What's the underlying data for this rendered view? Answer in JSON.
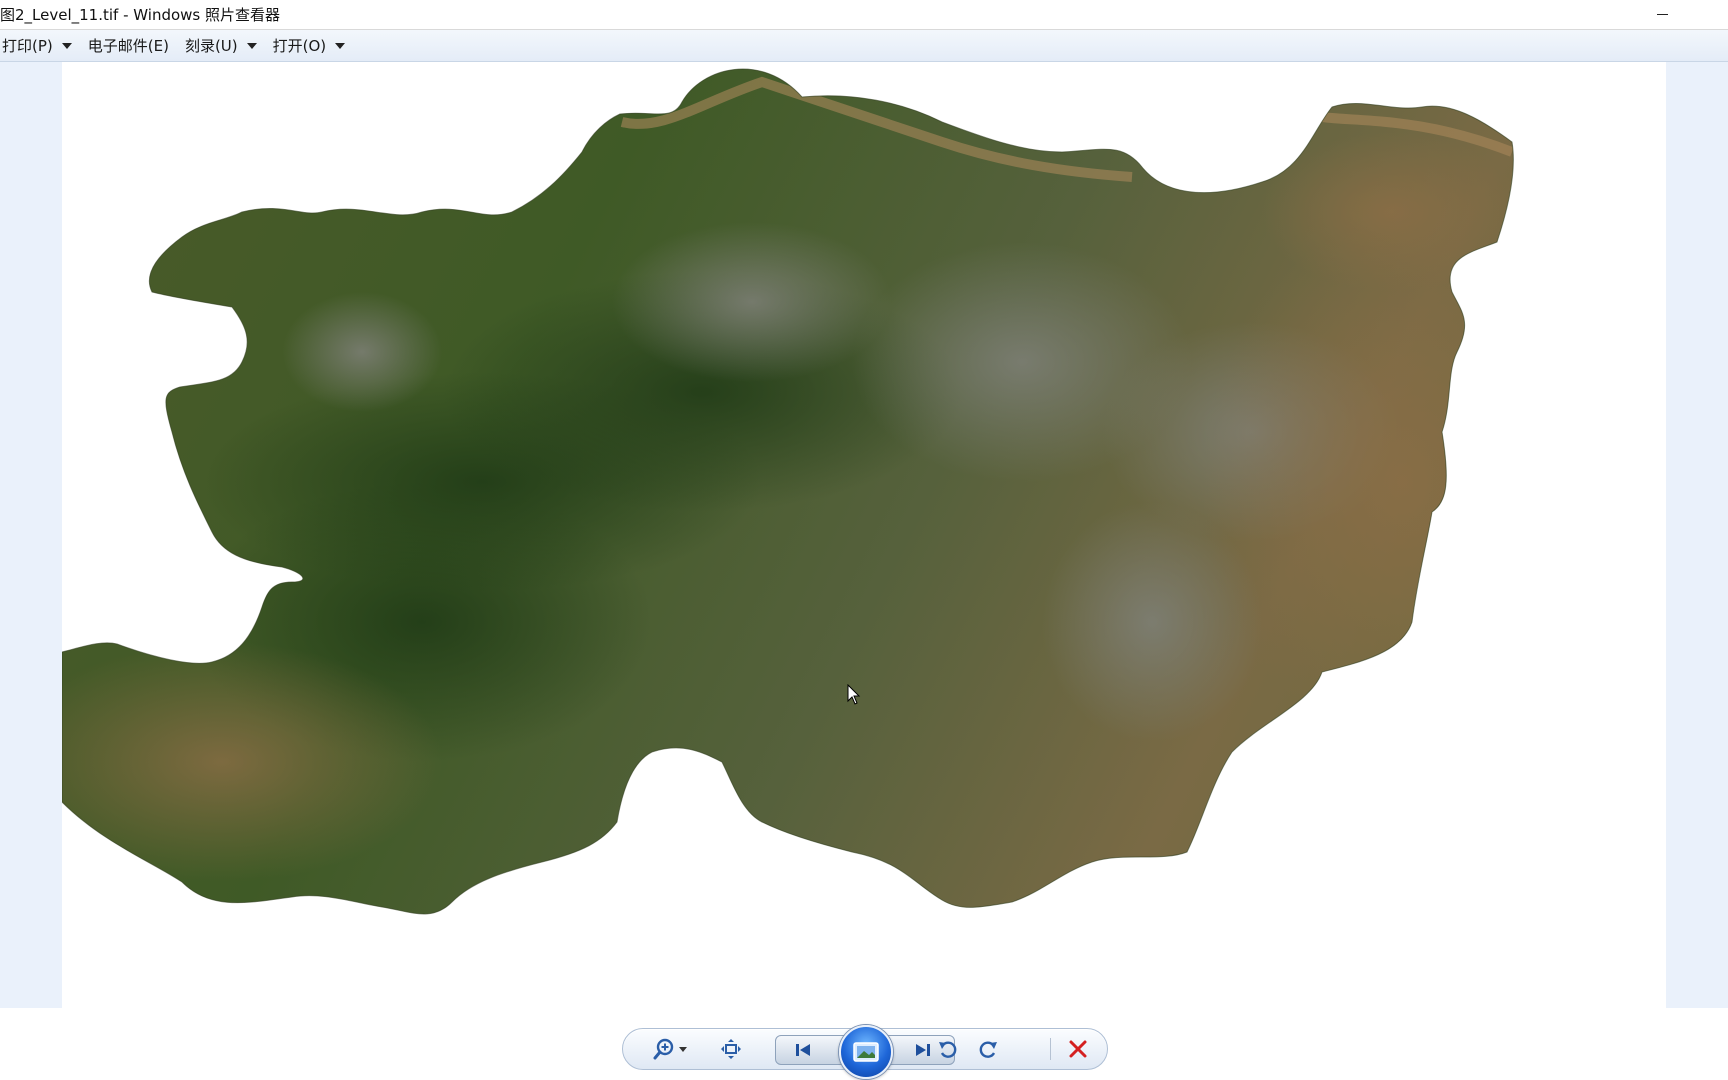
{
  "window": {
    "title": "图2_Level_11.tif - Windows 照片查看器",
    "minimize_glyph": "—"
  },
  "menu": {
    "items": [
      {
        "label": "打印(P)",
        "has_dropdown": true
      },
      {
        "label": "电子邮件(E)",
        "has_dropdown": false
      },
      {
        "label": "刻录(U)",
        "has_dropdown": true
      },
      {
        "label": "打开(O)",
        "has_dropdown": true
      }
    ]
  },
  "viewer": {
    "background_color": "#eaf1fb",
    "image_description_icon": "satellite-map-image"
  },
  "toolbar": {
    "buttons": [
      {
        "name": "zoom-button",
        "icon": "magnifier-zoom-icon"
      },
      {
        "name": "actual-size-button",
        "icon": "fit-window-icon"
      },
      {
        "name": "previous-button",
        "icon": "previous-icon"
      },
      {
        "name": "slideshow-button",
        "icon": "slideshow-icon"
      },
      {
        "name": "next-button",
        "icon": "next-icon"
      },
      {
        "name": "rotate-counterclockwise-button",
        "icon": "rotate-left-icon"
      },
      {
        "name": "rotate-clockwise-button",
        "icon": "rotate-right-icon"
      },
      {
        "name": "delete-button",
        "icon": "delete-x-icon"
      }
    ],
    "colors": {
      "accent_blue": "#1e66d8",
      "delete_red": "#d42020",
      "icon_blue": "#2a5ea8"
    }
  }
}
